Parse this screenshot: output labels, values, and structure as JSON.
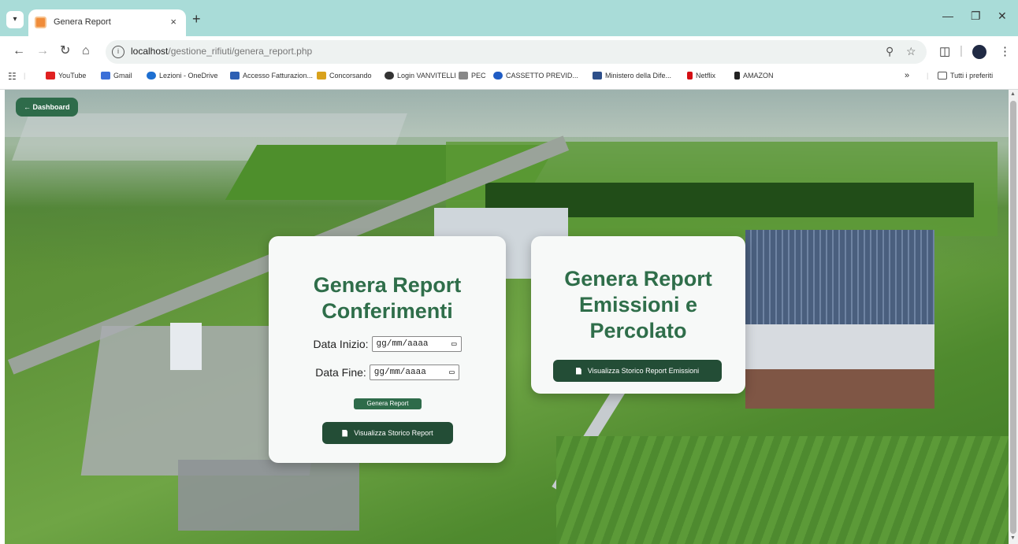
{
  "browser": {
    "tab_title": "Genera Report",
    "tab_close": "×",
    "new_tab": "+",
    "url_host": "localhost",
    "url_path": "/gestione_rifiuti/genera_report.php",
    "bookmarks": [
      {
        "label": "YouTube",
        "color": "#e02020"
      },
      {
        "label": "Gmail",
        "color": "#3b6fd8"
      },
      {
        "label": "Lezioni - OneDrive",
        "color": "#1d6fd1"
      },
      {
        "label": "Accesso Fatturazion...",
        "color": "#2d5fb3"
      },
      {
        "label": "Concorsando",
        "color": "#d9a21c"
      },
      {
        "label": "Login VANVITELLI",
        "color": "#333333"
      },
      {
        "label": "PEC",
        "color": "#888888"
      },
      {
        "label": "CASSETTO PREVID...",
        "color": "#1f5cc4"
      },
      {
        "label": "Ministero della Dife...",
        "color": "#2d4f8a"
      },
      {
        "label": "Netflix",
        "color": "#d40f14"
      },
      {
        "label": "AMAZON",
        "color": "#222222"
      }
    ],
    "all_bookmarks": "Tutti i preferiti",
    "more_bookmarks": "»"
  },
  "page": {
    "dashboard_button": "← Dashboard",
    "card1": {
      "title_line1": "Genera Report",
      "title_line2": "Conferimenti",
      "start_label": "Data Inizio:",
      "end_label": "Data Fine:",
      "date_placeholder": "gg/mm/aaaa",
      "generate_button": "Genera Report",
      "history_button": "Visualizza Storico Report"
    },
    "card2": {
      "title_line1": "Genera Report",
      "title_line2": "Emissioni e",
      "title_line3": "Percolato",
      "history_button": "Visualizza Storico Report Emissioni"
    }
  },
  "colors": {
    "accent": "#2f6e4a",
    "button_dark": "#234d36",
    "tabstrip": "#a9dcd8"
  }
}
